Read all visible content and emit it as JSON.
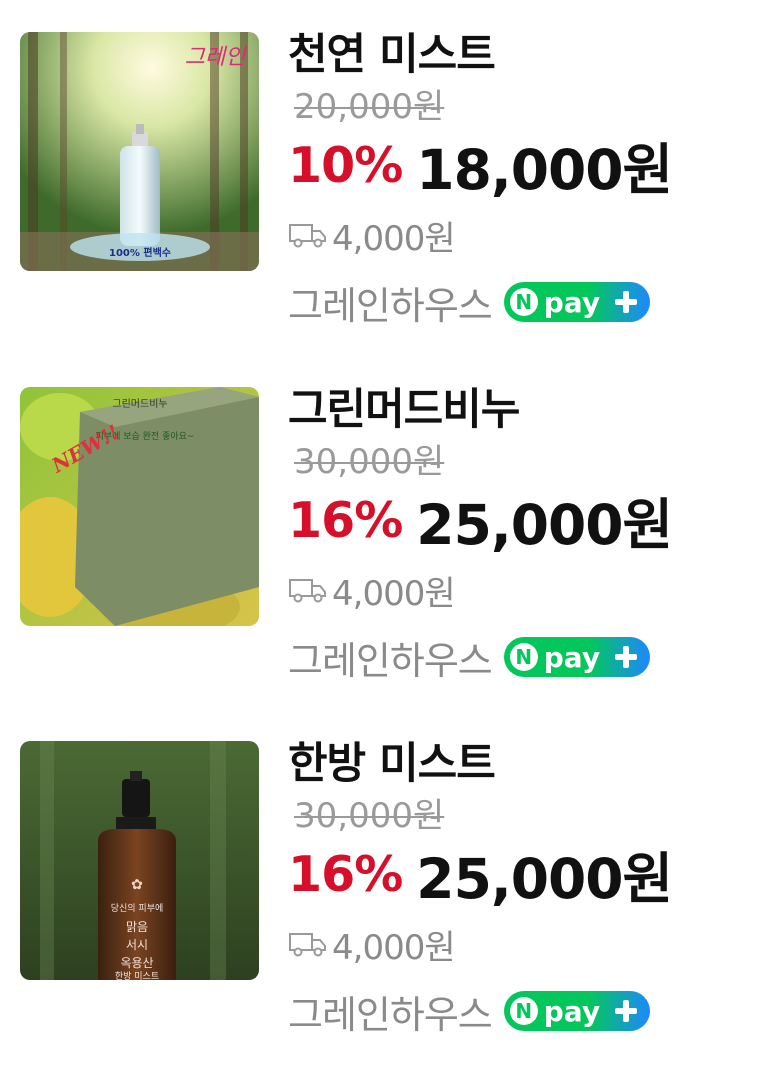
{
  "products": [
    {
      "name": "천연 미스트",
      "original_price": "20,000원",
      "discount": "10%",
      "price": "18,000원",
      "shipping": "4,000원",
      "seller": "그레인하우스",
      "badge": "pay",
      "thumb_text": [
        "100% 편백수"
      ],
      "thumb_logo": "그레인"
    },
    {
      "name": "그린머드비누",
      "original_price": "30,000원",
      "discount": "16%",
      "price": "25,000원",
      "shipping": "4,000원",
      "seller": "그레인하우스",
      "badge": "pay",
      "thumb_text": [
        "그린머드비누",
        "피부에 보습 완전 좋아요~"
      ],
      "thumb_logo": "NEW!!"
    },
    {
      "name": "한방 미스트",
      "original_price": "30,000원",
      "discount": "16%",
      "price": "25,000원",
      "shipping": "4,000원",
      "seller": "그레인하우스",
      "badge": "pay",
      "thumb_text": [
        "당신의 피부에",
        "맑음",
        "서시",
        "옥용산",
        "한방 미스트"
      ],
      "thumb_logo": ""
    }
  ],
  "colors": {
    "discount": "#d6102b",
    "npay_green": "#03c75a",
    "npay_blue": "#1e88ff",
    "muted": "#8a8a8a"
  },
  "icons": {
    "shipping": "truck-icon",
    "npay": "npay-plus-badge"
  }
}
